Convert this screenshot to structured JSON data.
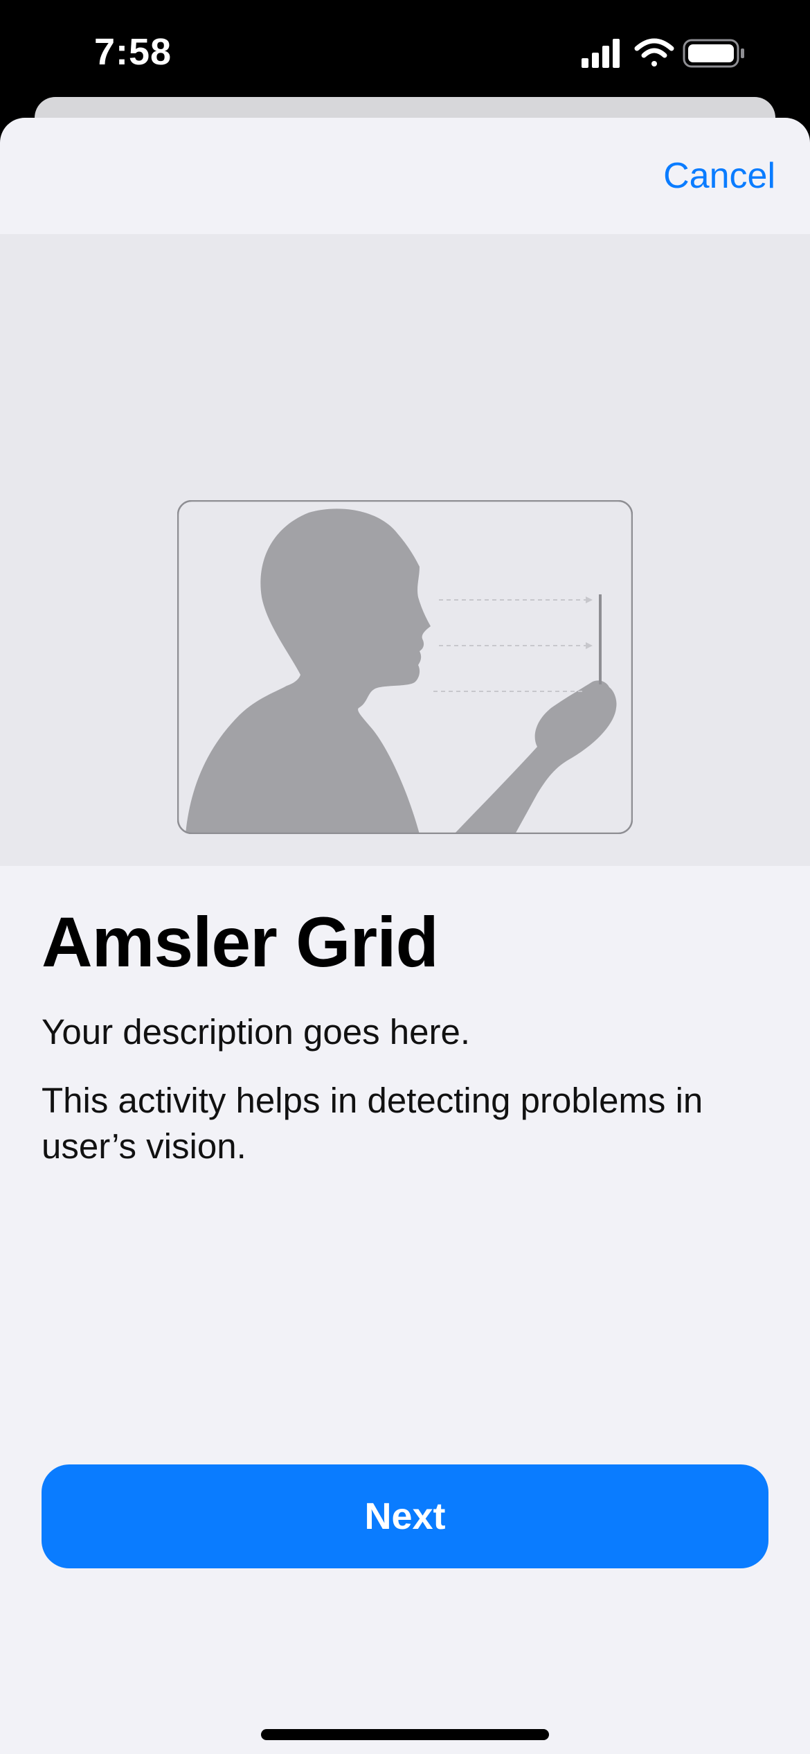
{
  "status_bar": {
    "time": "7:58",
    "icons": [
      "cellular-signal-icon",
      "wifi-icon",
      "battery-icon"
    ]
  },
  "nav": {
    "cancel_label": "Cancel"
  },
  "hero": {
    "illustration": "person-holding-device-at-distance-illustration"
  },
  "content": {
    "title": "Amsler Grid",
    "description": "Your description goes here.",
    "detail": "This activity helps in detecting problems in user’s vision."
  },
  "footer": {
    "next_label": "Next"
  },
  "colors": {
    "accent": "#0a7cff",
    "sheet_background": "#f2f2f7",
    "hero_background": "#e8e8ed",
    "silhouette": "#a2a2a6"
  }
}
